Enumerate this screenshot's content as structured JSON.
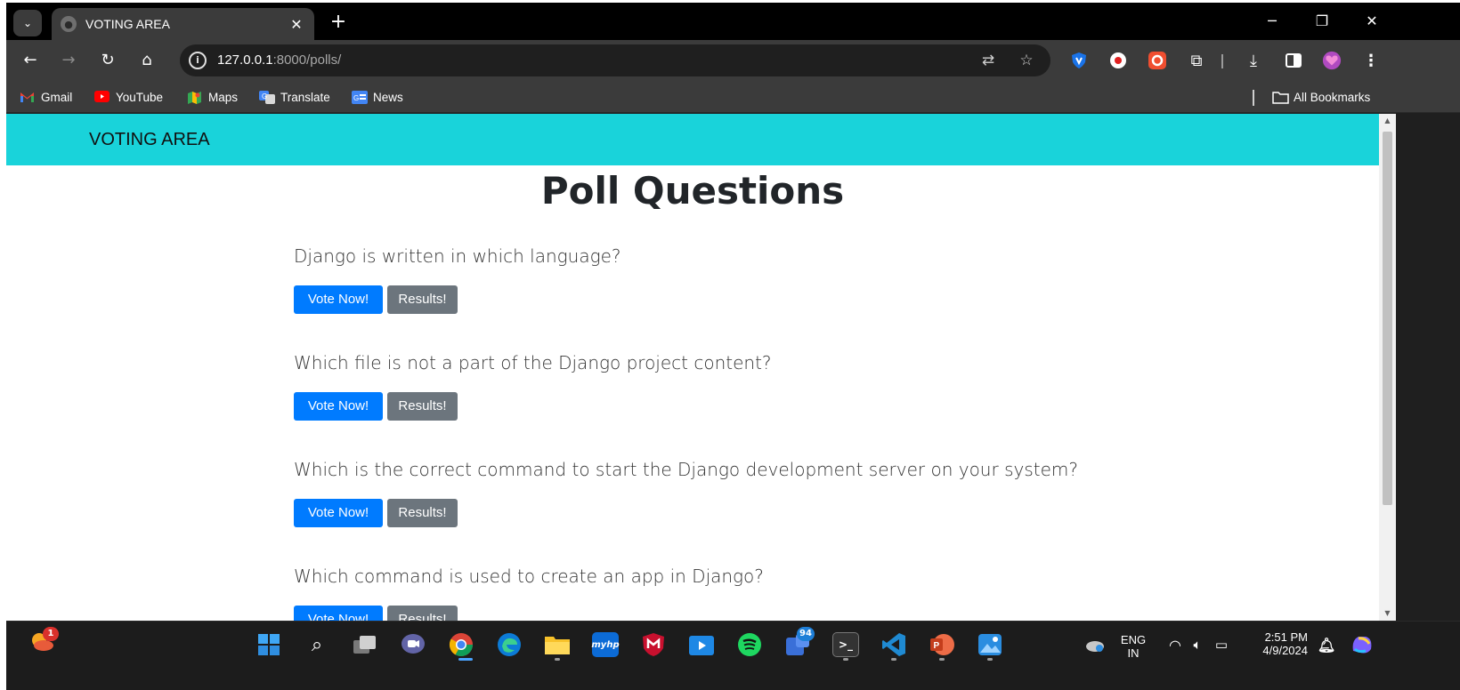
{
  "browser": {
    "tab_title": "VOTING AREA",
    "url_host": "127.0.0.1",
    "url_rest": ":8000/polls/",
    "new_tab_symbol": "+",
    "close_symbol": "✕"
  },
  "bookmarks": [
    {
      "label": "Gmail",
      "color": "#ea4335"
    },
    {
      "label": "YouTube",
      "color": "#ff0000"
    },
    {
      "label": "Maps",
      "color": "#34a853"
    },
    {
      "label": "Translate",
      "color": "#4285f4"
    },
    {
      "label": "News",
      "color": "#4285f4"
    }
  ],
  "all_bookmarks_label": "All Bookmarks",
  "page": {
    "brand": "VOTING AREA",
    "heading": "Poll Questions",
    "navbar_color": "#19d3da",
    "vote_label": "Vote Now!",
    "results_label": "Results!",
    "questions": [
      "Django is written in which language?",
      "Which file is not a part of the Django project content?",
      "Which is the correct command to start the Django development server on your system?",
      "Which command is used to create an app in Django?"
    ]
  },
  "taskbar": {
    "weather_badge": "1",
    "teams_badge": "94",
    "language_line1": "ENG",
    "language_line2": "IN",
    "time": "2:51 PM",
    "date": "4/9/2024",
    "myhp_label": "myhp"
  }
}
